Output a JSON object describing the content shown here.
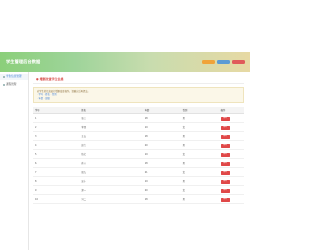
{
  "header": {
    "title": "学生管理后台数据",
    "buttons": [
      "",
      "",
      ""
    ]
  },
  "sidebar": {
    "items": [
      {
        "label": "学生信息管理",
        "active": true
      },
      {
        "label": "课程管理",
        "active": false
      }
    ]
  },
  "panel": {
    "title": "增删改查学生信息",
    "notice_line1": "对学生的信息进行增删改查操作，请确认后再提交。",
    "notice_link1": "· 学号 · 姓名 · 性别",
    "notice_link2": "· 年龄 · 班级"
  },
  "table": {
    "columns": [
      "学号",
      "姓名",
      "年龄",
      "性别",
      "操作"
    ],
    "rows": [
      {
        "id": "1",
        "name": "张三",
        "age": "18",
        "gender": "男",
        "action": "删除"
      },
      {
        "id": "2",
        "name": "李四",
        "age": "19",
        "gender": "女",
        "action": "删除"
      },
      {
        "id": "3",
        "name": "王五",
        "age": "18",
        "gender": "男",
        "action": "删除"
      },
      {
        "id": "4",
        "name": "赵六",
        "age": "20",
        "gender": "男",
        "action": "删除"
      },
      {
        "id": "5",
        "name": "钱七",
        "age": "19",
        "gender": "女",
        "action": "删除"
      },
      {
        "id": "6",
        "name": "孙八",
        "age": "18",
        "gender": "男",
        "action": "删除"
      },
      {
        "id": "7",
        "name": "周九",
        "age": "21",
        "gender": "女",
        "action": "删除"
      },
      {
        "id": "8",
        "name": "吴十",
        "age": "19",
        "gender": "男",
        "action": "删除"
      },
      {
        "id": "9",
        "name": "郑一",
        "age": "20",
        "gender": "女",
        "action": "删除"
      },
      {
        "id": "10",
        "name": "冯二",
        "age": "18",
        "gender": "男",
        "action": "删除"
      }
    ]
  },
  "colors": {
    "header_start": "#8bcf7a",
    "header_end": "#e7d9a4",
    "delete_button": "#e04848",
    "title_red": "#d9534f"
  }
}
